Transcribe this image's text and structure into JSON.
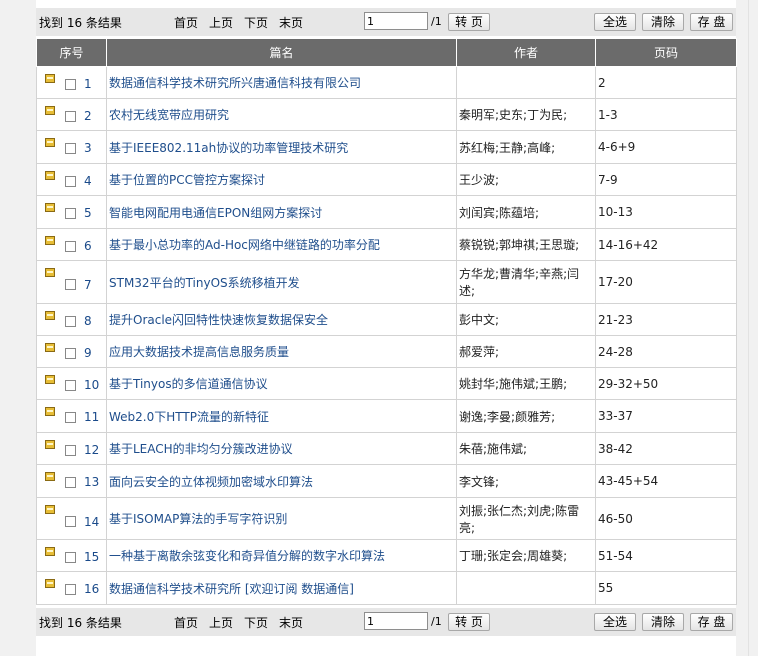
{
  "pager": {
    "result_count": "找到 16 条结果",
    "first": "首页",
    "prev": "上页",
    "next": "下页",
    "last": "末页",
    "page_value": "1",
    "total_pages": "/1",
    "go_button": "转 页",
    "select_all": "全选",
    "clear": "清除",
    "save": "存 盘"
  },
  "table": {
    "headers": [
      "序号",
      "篇名",
      "作者",
      "页码"
    ],
    "rows": [
      {
        "num": "1",
        "title": "数据通信科学技术研究所兴唐通信科技有限公司",
        "author": "",
        "pages": "2"
      },
      {
        "num": "2",
        "title": "农村无线宽带应用研究",
        "author": "秦明军;史东;丁为民;",
        "pages": "1-3"
      },
      {
        "num": "3",
        "title": "基于IEEE802.11ah协议的功率管理技术研究",
        "author": "苏红梅;王静;高峰;",
        "pages": "4-6+9"
      },
      {
        "num": "4",
        "title": "基于位置的PCC管控方案探讨",
        "author": "王少波;",
        "pages": "7-9"
      },
      {
        "num": "5",
        "title": "智能电网配用电通信EPON组网方案探讨",
        "author": "刘闰宾;陈蕴培;",
        "pages": "10-13"
      },
      {
        "num": "6",
        "title": "基于最小总功率的Ad-Hoc网络中继链路的功率分配",
        "author": "蔡锐锐;郭坤祺;王思璇;",
        "pages": "14-16+42"
      },
      {
        "num": "7",
        "title": "STM32平台的TinyOS系统移植开发",
        "author": "方华龙;曹清华;辛燕;闫述;",
        "pages": "17-20"
      },
      {
        "num": "8",
        "title": "提升Oracle闪回特性快速恢复数据保安全",
        "author": "彭中文;",
        "pages": "21-23"
      },
      {
        "num": "9",
        "title": "应用大数据技术提高信息服务质量",
        "author": "郝爱萍;",
        "pages": "24-28"
      },
      {
        "num": "10",
        "title": "基于Tinyos的多信道通信协议",
        "author": "姚封华;施伟斌;王鹏;",
        "pages": "29-32+50"
      },
      {
        "num": "11",
        "title": "Web2.0下HTTP流量的新特征",
        "author": "谢逸;李曼;颜雅芳;",
        "pages": "33-37"
      },
      {
        "num": "12",
        "title": "基于LEACH的非均匀分簇改进协议",
        "author": "朱蓓;施伟斌;",
        "pages": "38-42"
      },
      {
        "num": "13",
        "title": "面向云安全的立体视频加密域水印算法",
        "author": "李文锋;",
        "pages": "43-45+54"
      },
      {
        "num": "14",
        "title": "基于ISOMAP算法的手写字符识别",
        "author": "刘振;张仁杰;刘虎;陈雷亮;",
        "pages": "46-50"
      },
      {
        "num": "15",
        "title": "一种基于离散余弦变化和奇异值分解的数字水印算法",
        "author": "丁珊;张定会;周雄葵;",
        "pages": "51-54"
      },
      {
        "num": "16",
        "title": "数据通信科学技术研究所 [欢迎订阅 数据通信]",
        "author": "",
        "pages": "55"
      }
    ]
  }
}
